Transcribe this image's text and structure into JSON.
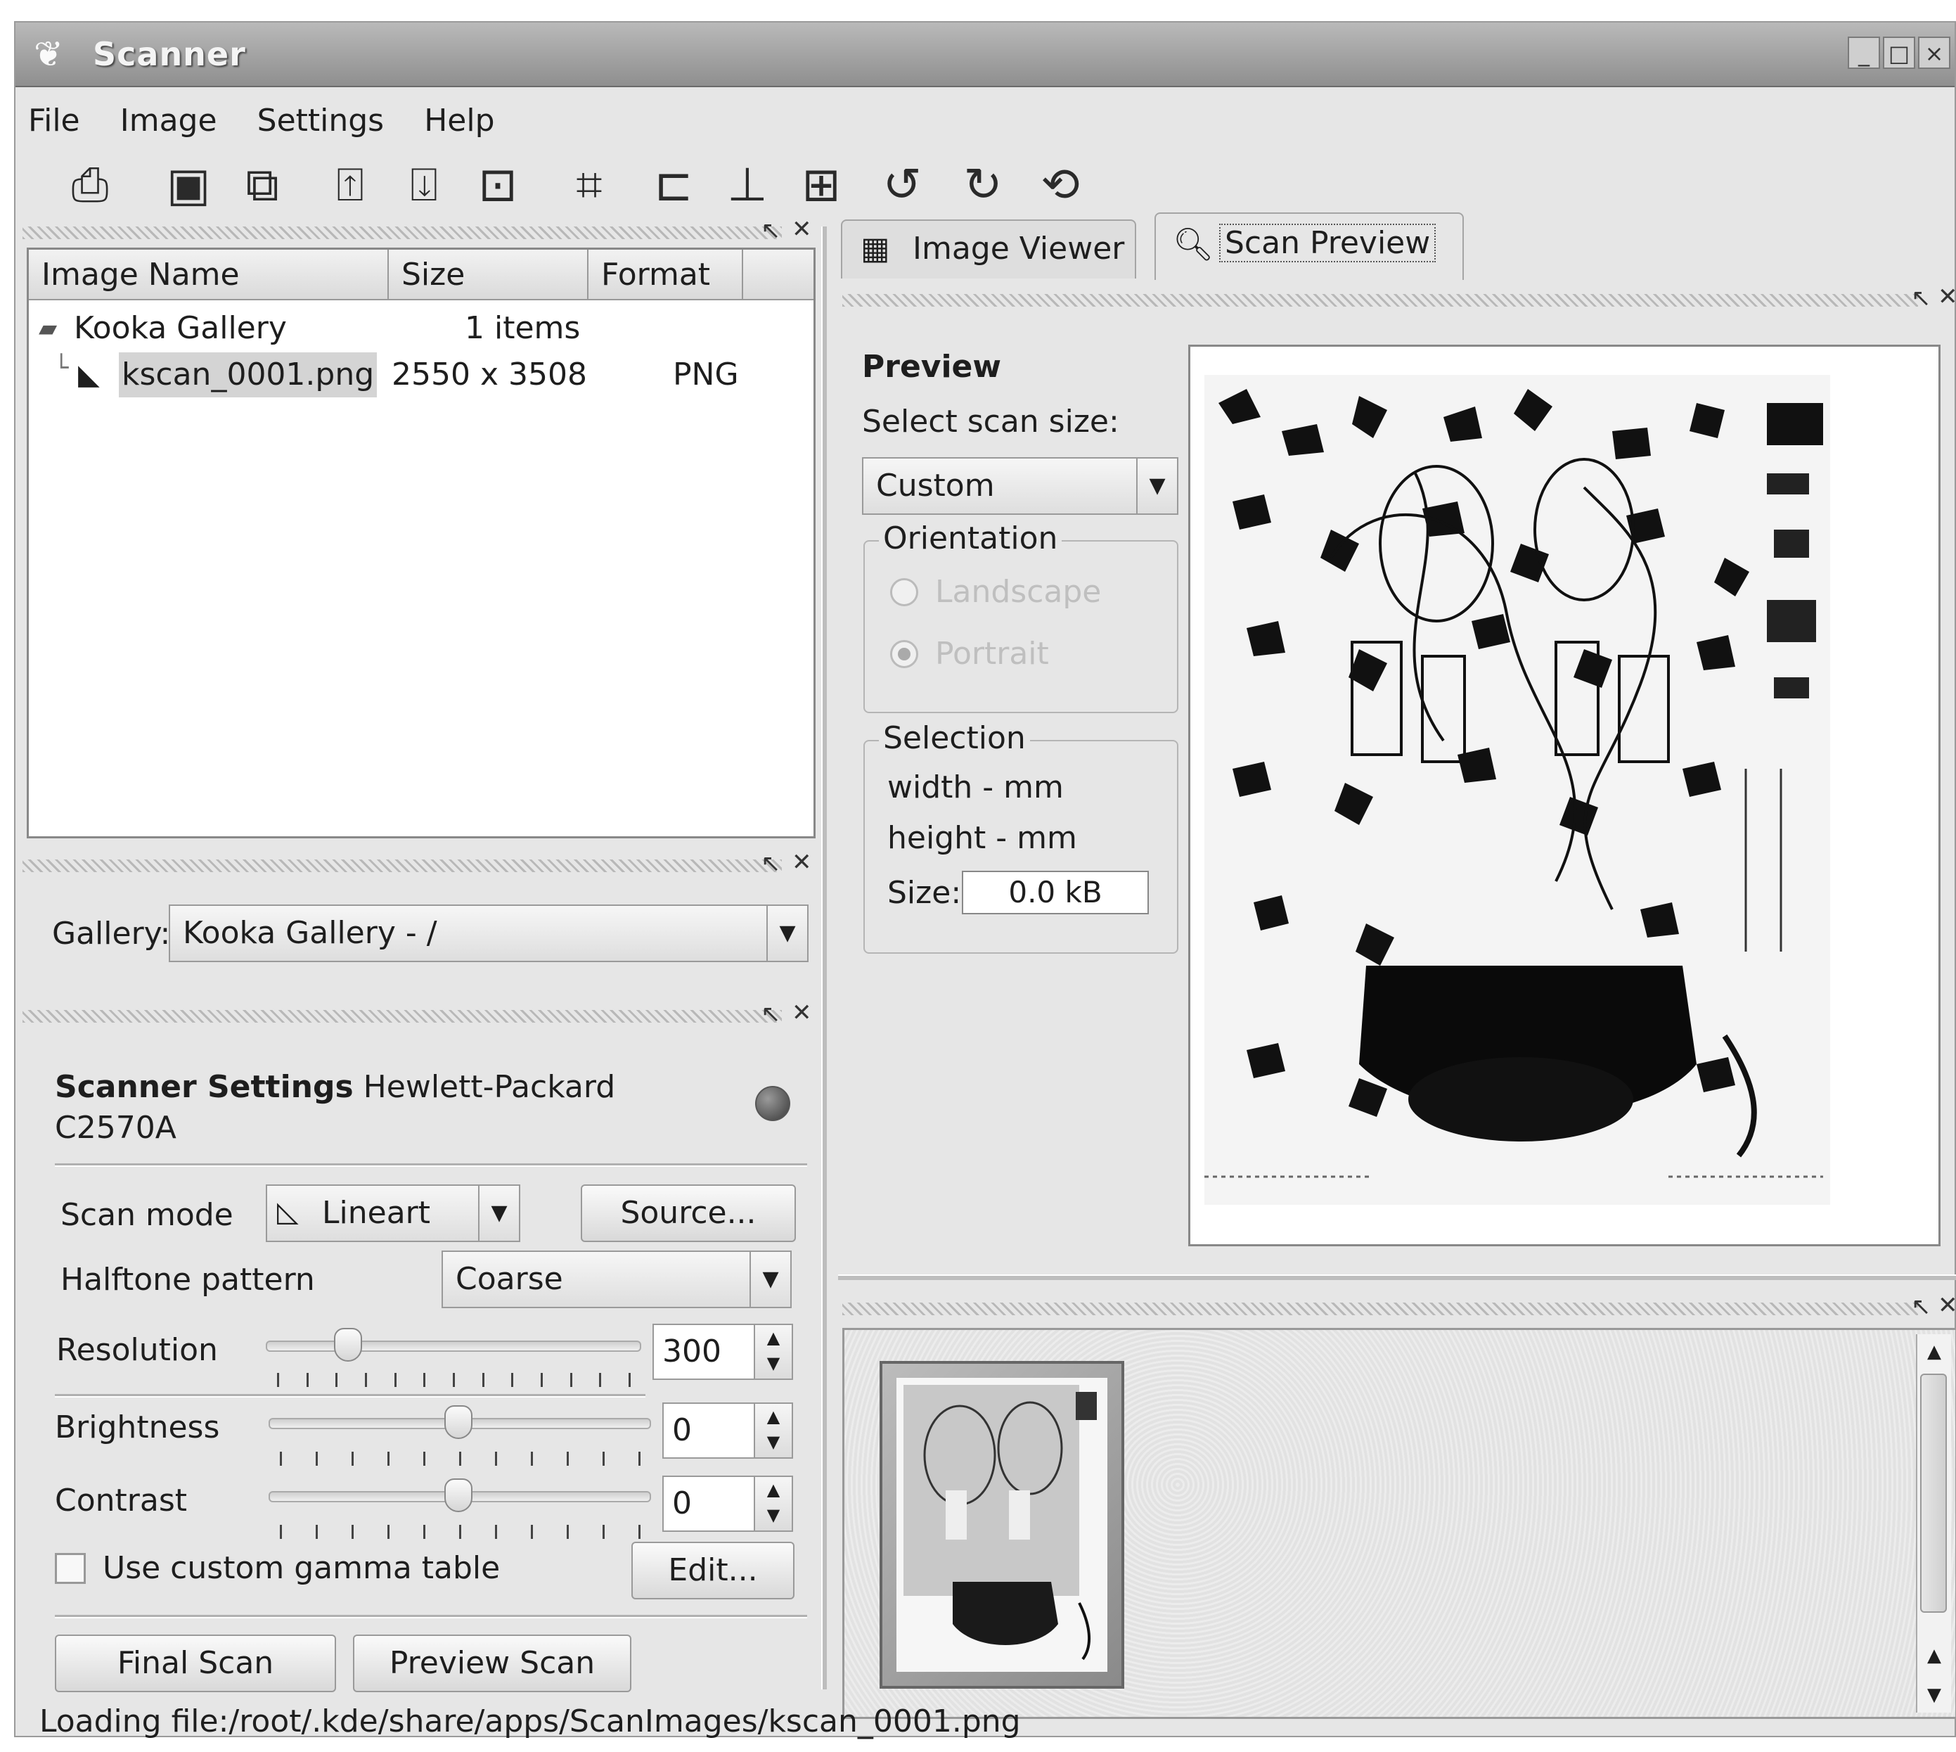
{
  "window": {
    "title": "Scanner",
    "controls": {
      "minimize": "_",
      "maximize": "□",
      "close": "×"
    }
  },
  "menu": {
    "items": [
      "File",
      "Image",
      "Settings",
      "Help"
    ]
  },
  "toolbar": {
    "icons": [
      "print-icon",
      "zoom-to-fit-icon",
      "zoom-to-width-icon",
      "fit-height-icon",
      "fit-width-icon",
      "original-size-icon",
      "crop-icon",
      "mirror-vertical-icon",
      "mirror-horizontal-icon",
      "mirror-both-icon",
      "rotate-left-icon",
      "rotate-right-icon",
      "rotate-180-icon"
    ]
  },
  "dock": {
    "undock_symbol": "↖",
    "close_symbol": "✕"
  },
  "gallery_list": {
    "columns": [
      "Image Name",
      "Size",
      "Format"
    ],
    "rows": [
      {
        "name": "Kooka Gallery",
        "size": "1 items",
        "format": ""
      },
      {
        "name": "kscan_0001.png",
        "size": "2550 x 3508",
        "format": "PNG"
      }
    ]
  },
  "gallery_selector": {
    "label": "Gallery:",
    "value": "Kooka Gallery - /"
  },
  "scanner_settings": {
    "heading_bold": "Scanner Settings",
    "device_line1": "Hewlett-Packard",
    "device_line2": "C2570A",
    "scan_mode_label": "Scan mode",
    "scan_mode_value": "Lineart",
    "source_button": "Source...",
    "halftone_label": "Halftone pattern",
    "halftone_value": "Coarse",
    "resolution_label": "Resolution",
    "resolution_value": "300",
    "resolution_position": 0.22,
    "brightness_label": "Brightness",
    "brightness_value": "0",
    "brightness_position": 0.5,
    "contrast_label": "Contrast",
    "contrast_value": "0",
    "contrast_position": 0.5,
    "gamma_label": "Use custom gamma table",
    "gamma_checked": false,
    "edit_button": "Edit...",
    "final_scan_button": "Final Scan",
    "preview_scan_button": "Preview Scan"
  },
  "tabs": {
    "image_viewer": "Image Viewer",
    "scan_preview": "Scan Preview",
    "active": "Scan Preview"
  },
  "preview": {
    "heading": "Preview",
    "select_size_label": "Select scan size:",
    "size_value": "Custom",
    "orientation_title": "Orientation",
    "landscape_label": "Landscape",
    "portrait_label": "Portrait",
    "selection_title": "Selection",
    "width_text": "width - mm",
    "height_text": "height - mm",
    "size_label": "Size:",
    "size_kb": "0.0 kB"
  },
  "status": {
    "text": "Loading file:/root/.kde/share/apps/ScanImages/kscan_0001.png"
  },
  "colors": {
    "window_bg": "#e6e6e6",
    "titlebar": "#9a9a9a",
    "list_bg": "#ffffff"
  }
}
